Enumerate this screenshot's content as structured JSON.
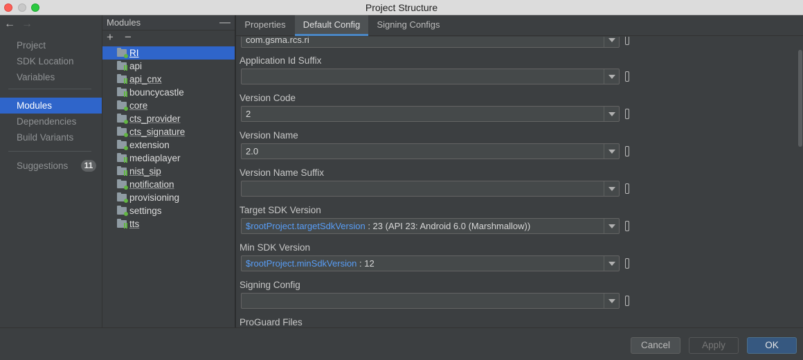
{
  "window": {
    "title": "Project Structure"
  },
  "nav": {
    "back_glyph": "←",
    "forward_glyph": "→",
    "items": [
      {
        "label": "Project"
      },
      {
        "label": "SDK Location"
      },
      {
        "label": "Variables"
      },
      {
        "label": "Modules"
      },
      {
        "label": "Dependencies"
      },
      {
        "label": "Build Variants"
      },
      {
        "label": "Suggestions",
        "badge": "11"
      }
    ],
    "selected": "Modules"
  },
  "modules": {
    "header": "Modules",
    "collapse_glyph": "—",
    "add_glyph": "+",
    "remove_glyph": "−",
    "selected": "RI",
    "items": [
      {
        "label": "RI",
        "icon": "app-module-icon"
      },
      {
        "label": "api",
        "icon": "library-module-icon"
      },
      {
        "label": "api_cnx",
        "icon": "library-module-icon"
      },
      {
        "label": "bouncycastle",
        "icon": "library-module-icon"
      },
      {
        "label": "core",
        "icon": "app-module-icon"
      },
      {
        "label": "cts_provider",
        "icon": "app-module-icon"
      },
      {
        "label": "cts_signature",
        "icon": "app-module-icon"
      },
      {
        "label": "extension",
        "icon": "app-module-icon"
      },
      {
        "label": "mediaplayer",
        "icon": "library-module-icon"
      },
      {
        "label": "nist_sip",
        "icon": "library-module-icon"
      },
      {
        "label": "notification",
        "icon": "app-module-icon"
      },
      {
        "label": "provisioning",
        "icon": "app-module-icon"
      },
      {
        "label": "settings",
        "icon": "app-module-icon"
      },
      {
        "label": "tts",
        "icon": "library-module-icon"
      }
    ]
  },
  "tabs": [
    {
      "label": "Properties"
    },
    {
      "label": "Default Config"
    },
    {
      "label": "Signing Configs"
    }
  ],
  "active_tab": "Default Config",
  "form": {
    "top_value": "com.gsma.rcs.ri",
    "fields": [
      {
        "label": "Application Id Suffix",
        "value": "",
        "ref": ""
      },
      {
        "label": "Version Code",
        "value": "2",
        "ref": ""
      },
      {
        "label": "Version Name",
        "value": "2.0",
        "ref": ""
      },
      {
        "label": "Version Name Suffix",
        "value": "",
        "ref": ""
      },
      {
        "label": "Target SDK Version",
        "ref": "$rootProject.targetSdkVersion",
        "value": " : 23 (API 23: Android 6.0 (Marshmallow))"
      },
      {
        "label": "Min SDK Version",
        "ref": "$rootProject.minSdkVersion",
        "value": " : 12"
      },
      {
        "label": "Signing Config",
        "value": "",
        "ref": ""
      },
      {
        "label": "ProGuard Files"
      }
    ]
  },
  "footer": {
    "cancel": "Cancel",
    "apply": "Apply",
    "ok": "OK"
  },
  "colors": {
    "selection": "#2f65ca",
    "link": "#589df6",
    "ok_button": "#365880",
    "module_badge": "#62b543"
  }
}
